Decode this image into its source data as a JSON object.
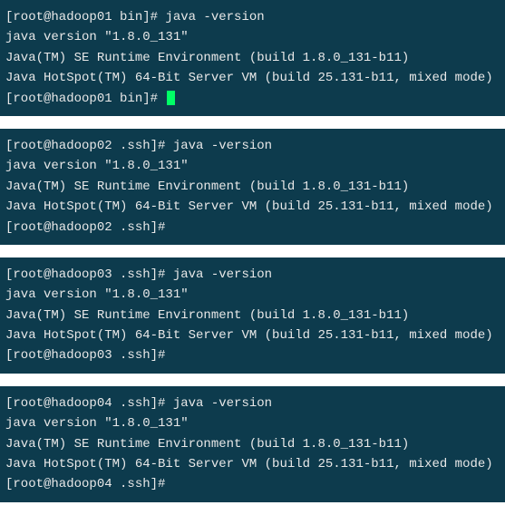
{
  "terminals": [
    {
      "prompt_line": "[root@hadoop01 bin]# java -version",
      "output1": "java version \"1.8.0_131\"",
      "output2": "Java(TM) SE Runtime Environment (build 1.8.0_131-b11)",
      "output3": "Java HotSpot(TM) 64-Bit Server VM (build 25.131-b11, mixed mode)",
      "prompt_end": "[root@hadoop01 bin]# ",
      "has_cursor": true
    },
    {
      "prompt_line": "[root@hadoop02 .ssh]# java -version",
      "output1": "java version \"1.8.0_131\"",
      "output2": "Java(TM) SE Runtime Environment (build 1.8.0_131-b11)",
      "output3": "Java HotSpot(TM) 64-Bit Server VM (build 25.131-b11, mixed mode)",
      "prompt_end": "[root@hadoop02 .ssh]#",
      "has_cursor": false
    },
    {
      "prompt_line": "[root@hadoop03 .ssh]# java -version",
      "output1": "java version \"1.8.0_131\"",
      "output2": "Java(TM) SE Runtime Environment (build 1.8.0_131-b11)",
      "output3": "Java HotSpot(TM) 64-Bit Server VM (build 25.131-b11, mixed mode)",
      "prompt_end": "[root@hadoop03 .ssh]#",
      "has_cursor": false
    },
    {
      "prompt_line": "[root@hadoop04 .ssh]# java -version",
      "output1": "java version \"1.8.0_131\"",
      "output2": "Java(TM) SE Runtime Environment (build 1.8.0_131-b11)",
      "output3": "Java HotSpot(TM) 64-Bit Server VM (build 25.131-b11, mixed mode)",
      "prompt_end": "[root@hadoop04 .ssh]#",
      "has_cursor": false
    }
  ]
}
